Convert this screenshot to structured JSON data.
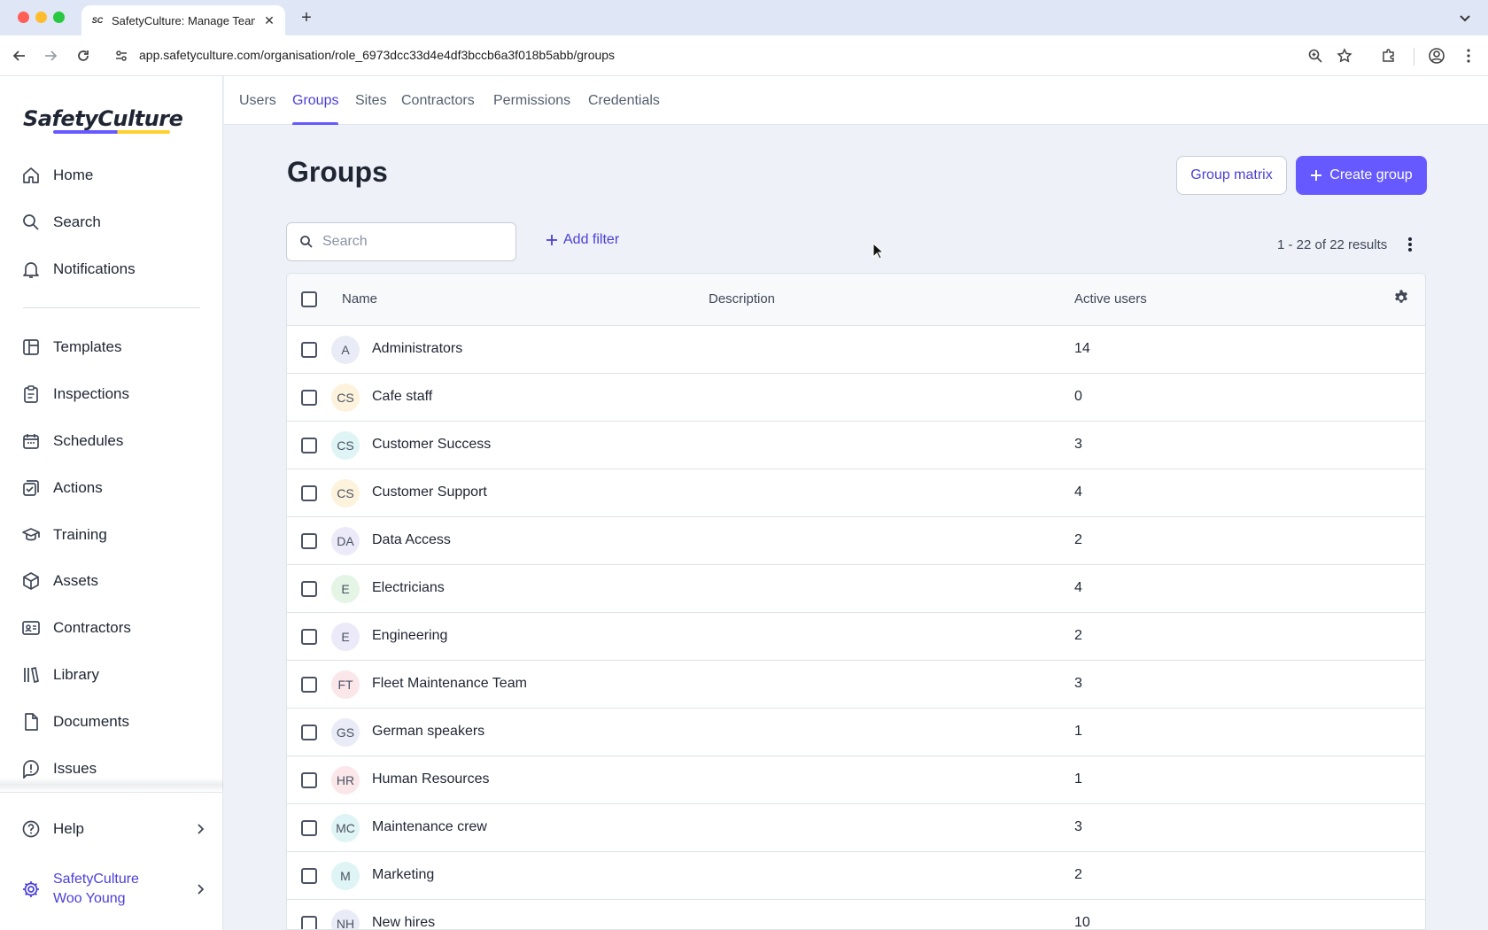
{
  "browser": {
    "tab_title": "SafetyCulture: Manage Teams",
    "tab_favicon": "SC",
    "url": "app.safetyculture.com/organisation/role_6973dcc33d4e4df3bccb6a3f018b5abb/groups"
  },
  "sidebar": {
    "logo": "SafetyCulture",
    "items": [
      {
        "label": "Home",
        "icon": "home-icon"
      },
      {
        "label": "Search",
        "icon": "search-icon"
      },
      {
        "label": "Notifications",
        "icon": "bell-icon"
      },
      {
        "label": "Templates",
        "icon": "templates-icon"
      },
      {
        "label": "Inspections",
        "icon": "clipboard-icon"
      },
      {
        "label": "Schedules",
        "icon": "calendar-icon"
      },
      {
        "label": "Actions",
        "icon": "actions-icon"
      },
      {
        "label": "Training",
        "icon": "graduation-cap-icon"
      },
      {
        "label": "Assets",
        "icon": "cube-icon"
      },
      {
        "label": "Contractors",
        "icon": "id-card-icon"
      },
      {
        "label": "Library",
        "icon": "library-icon"
      },
      {
        "label": "Documents",
        "icon": "document-icon"
      },
      {
        "label": "Issues",
        "icon": "alert-icon"
      }
    ],
    "help_label": "Help",
    "org_name": "SafetyCulture",
    "user_name": "Woo Young"
  },
  "topnav": {
    "tabs": [
      {
        "label": "Users",
        "active": false
      },
      {
        "label": "Groups",
        "active": true
      },
      {
        "label": "Sites",
        "active": false
      },
      {
        "label": "Contractors",
        "active": false
      },
      {
        "label": "Permissions",
        "active": false
      },
      {
        "label": "Credentials",
        "active": false
      }
    ]
  },
  "main": {
    "title": "Groups",
    "group_matrix_label": "Group matrix",
    "create_group_label": "Create group",
    "search_placeholder": "Search",
    "add_filter_label": "Add filter",
    "results_text": "1 - 22 of 22 results"
  },
  "table": {
    "columns": {
      "name": "Name",
      "description": "Description",
      "active_users": "Active users"
    },
    "rows": [
      {
        "initials": "A",
        "name": "Administrators",
        "description": "",
        "active_users": "14",
        "avatar_color": "#e9ecf6"
      },
      {
        "initials": "CS",
        "name": "Cafe staff",
        "description": "",
        "active_users": "0",
        "avatar_color": "#fdf3dc"
      },
      {
        "initials": "CS",
        "name": "Customer Success",
        "description": "",
        "active_users": "3",
        "avatar_color": "#dff4f4"
      },
      {
        "initials": "CS",
        "name": "Customer Support",
        "description": "",
        "active_users": "4",
        "avatar_color": "#fdf3dc"
      },
      {
        "initials": "DA",
        "name": "Data Access",
        "description": "",
        "active_users": "2",
        "avatar_color": "#eceaf8"
      },
      {
        "initials": "E",
        "name": "Electricians",
        "description": "",
        "active_users": "4",
        "avatar_color": "#e4f5e6"
      },
      {
        "initials": "E",
        "name": "Engineering",
        "description": "",
        "active_users": "2",
        "avatar_color": "#eceaf8"
      },
      {
        "initials": "FT",
        "name": "Fleet Maintenance Team",
        "description": "",
        "active_users": "3",
        "avatar_color": "#fbe7ea"
      },
      {
        "initials": "GS",
        "name": "German speakers",
        "description": "",
        "active_users": "1",
        "avatar_color": "#e9ecf6"
      },
      {
        "initials": "HR",
        "name": "Human Resources",
        "description": "",
        "active_users": "1",
        "avatar_color": "#fbe7ea"
      },
      {
        "initials": "MC",
        "name": "Maintenance crew",
        "description": "",
        "active_users": "3",
        "avatar_color": "#dff4f4"
      },
      {
        "initials": "M",
        "name": "Marketing",
        "description": "",
        "active_users": "2",
        "avatar_color": "#dff4f4"
      },
      {
        "initials": "NH",
        "name": "New hires",
        "description": "",
        "active_users": "10",
        "avatar_color": "#e9ecf6"
      }
    ]
  },
  "colors": {
    "accent": "#6559ff",
    "accent_text": "#4b3fd8",
    "page_bg": "#eef1f7"
  }
}
